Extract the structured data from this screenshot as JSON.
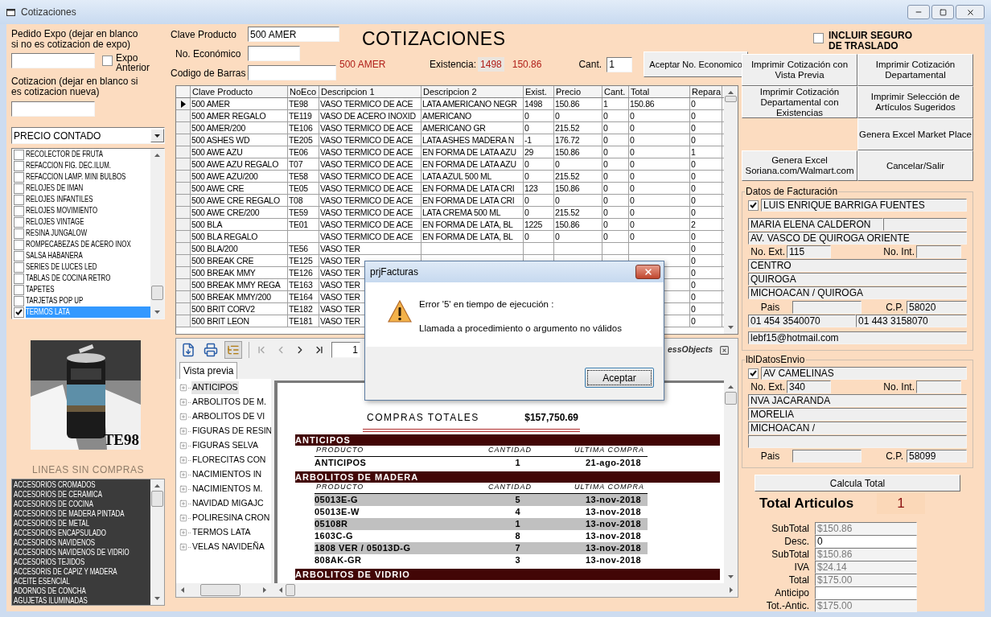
{
  "window": {
    "title": "Cotizaciones"
  },
  "pedido_expo": {
    "label": "Pedido Expo (dejar en blanco si no es cotizacion de expo)",
    "expo_anterior": {
      "label": "Expo Anterior",
      "checked": false
    }
  },
  "cotizacion": {
    "label": "Cotizacion (dejar en blanco si es cotizacion nueva)"
  },
  "price_list": {
    "value": "PRECIO CONTADO"
  },
  "lineas": [
    {
      "label": "RECOLECTOR DE FRUTA",
      "checked": false,
      "selected": false
    },
    {
      "label": "REFACCION FIG. DEC.ILUM.",
      "checked": false,
      "selected": false
    },
    {
      "label": "REFACCION LAMP. MINI BULBOS",
      "checked": false,
      "selected": false
    },
    {
      "label": "RELOJES DE IMAN",
      "checked": false,
      "selected": false
    },
    {
      "label": "RELOJES INFANTILES",
      "checked": false,
      "selected": false
    },
    {
      "label": "RELOJES MOVIMIENTO",
      "checked": false,
      "selected": false
    },
    {
      "label": "RELOJES VINTAGE",
      "checked": false,
      "selected": false
    },
    {
      "label": "RESINA JUNGALOW",
      "checked": false,
      "selected": false
    },
    {
      "label": "ROMPECABEZAS DE ACERO INOX",
      "checked": false,
      "selected": false
    },
    {
      "label": "SALSA HABANERA",
      "checked": false,
      "selected": false
    },
    {
      "label": "SERIES DE LUCES LED",
      "checked": false,
      "selected": false
    },
    {
      "label": "TABLAS DE COCINA RETRO",
      "checked": false,
      "selected": false
    },
    {
      "label": "TAPETES",
      "checked": false,
      "selected": false
    },
    {
      "label": "TARJETAS POP UP",
      "checked": false,
      "selected": false
    },
    {
      "label": "TERMOS LATA",
      "checked": true,
      "selected": true
    }
  ],
  "product_image": {
    "kind": "picture",
    "code": "TE98"
  },
  "lineas_sin_compras": {
    "title": "LINEAS SIN COMPRAS",
    "items": [
      "ACCESORIOS CROMADOS",
      "ACCESORIOS DE CERAMICA",
      "ACCESORIOS DE COCINA",
      "ACCESORIOS DE MADERA PINTADA",
      "ACCESORIOS DE METAL",
      "ACCESORIOS ENCAPSULADO",
      "ACCESORIOS NAVIDENOS",
      "ACCESORIOS NAVIDENOS DE VIDRIO",
      "ACCESORIOS TEJIDOS",
      "ACCESORIS DE CAPIZ Y MADERA",
      "ACEITE ESENCIAL",
      "ADORNOS DE CONCHA",
      "AGUJETAS ILUMINADAS"
    ]
  },
  "form": {
    "title": "COTIZACIONES",
    "clave_producto": {
      "label": "Clave Producto",
      "value": "500 AMER"
    },
    "no_economico": {
      "label": "No. Económico"
    },
    "codigo_barras": {
      "label": "Codigo de Barras"
    },
    "producto": "500 AMER",
    "existencia": {
      "label": "Existencia:",
      "value": "1498"
    },
    "precio": "150.86",
    "cantidad": {
      "label": "Cant.",
      "value": "1"
    },
    "accept_button": "Aceptar No. Economico"
  },
  "grid": {
    "columns": [
      "Clave Producto",
      "NoEco",
      "Descripcion 1",
      "Descripcion 2",
      "Exist.",
      "Precio",
      "Cant.",
      "Total",
      "Repara"
    ],
    "rows": [
      {
        "selected": true,
        "clave": "500 AMER",
        "no_eco": "TE98",
        "descripcion_1": "VASO TERMICO DE ACE",
        "descripcion_2": "LATA AMERICANO NEGR",
        "exist": "1498",
        "precio": "150.86",
        "cant": "1",
        "total": "150.86",
        "repara": "0"
      },
      {
        "selected": false,
        "clave": "500 AMER REGALO",
        "no_eco": "TE119",
        "descripcion_1": "VASO DE ACERO INOXID",
        "descripcion_2": "AMERICANO",
        "exist": "0",
        "precio": "0",
        "cant": "0",
        "total": "0",
        "repara": "0"
      },
      {
        "selected": false,
        "clave": "500 AMER/200",
        "no_eco": "TE106",
        "descripcion_1": "VASO TERMICO DE ACE",
        "descripcion_2": "AMERICANO GR",
        "exist": "0",
        "precio": "215.52",
        "cant": "0",
        "total": "0",
        "repara": "0"
      },
      {
        "selected": false,
        "clave": "500 ASHES WD",
        "no_eco": "TE205",
        "descripcion_1": "VASO TERMICO DE ACE",
        "descripcion_2": "LATA ASHES MADERA N",
        "exist": "-1",
        "precio": "176.72",
        "cant": "0",
        "total": "0",
        "repara": "0"
      },
      {
        "selected": false,
        "clave": "500 AWE AZU",
        "no_eco": "TE06",
        "descripcion_1": "VASO TERMICO DE ACE",
        "descripcion_2": "EN FORMA DE LATA AZU",
        "exist": "29",
        "precio": "150.86",
        "cant": "0",
        "total": "0",
        "repara": "1"
      },
      {
        "selected": false,
        "clave": "500 AWE AZU REGALO",
        "no_eco": "T07",
        "descripcion_1": "VASO TERMICO DE ACE",
        "descripcion_2": "EN FORMA DE LATA AZU",
        "exist": "0",
        "precio": "0",
        "cant": "0",
        "total": "0",
        "repara": "0"
      },
      {
        "selected": false,
        "clave": "500 AWE AZU/200",
        "no_eco": "TE58",
        "descripcion_1": "VASO TERMICO DE ACE",
        "descripcion_2": "LATA AZUL 500 ML",
        "exist": "0",
        "precio": "215.52",
        "cant": "0",
        "total": "0",
        "repara": "0"
      },
      {
        "selected": false,
        "clave": "500 AWE CRE",
        "no_eco": "TE05",
        "descripcion_1": "VASO TERMICO DE ACE",
        "descripcion_2": "EN FORMA DE LATA CRI",
        "exist": "123",
        "precio": "150.86",
        "cant": "0",
        "total": "0",
        "repara": "0"
      },
      {
        "selected": false,
        "clave": "500 AWE CRE REGALO",
        "no_eco": "T08",
        "descripcion_1": "VASO TERMICO DE ACE",
        "descripcion_2": "EN FORMA DE LATA CRI",
        "exist": "0",
        "precio": "0",
        "cant": "0",
        "total": "0",
        "repara": "0"
      },
      {
        "selected": false,
        "clave": "500 AWE CRE/200",
        "no_eco": "TE59",
        "descripcion_1": "VASO TERMICO DE ACE",
        "descripcion_2": "LATA CREMA 500 ML",
        "exist": "0",
        "precio": "215.52",
        "cant": "0",
        "total": "0",
        "repara": "0"
      },
      {
        "selected": false,
        "clave": "500 BLA",
        "no_eco": "TE01",
        "descripcion_1": "VASO TERMICO DE ACE",
        "descripcion_2": "EN FORMA DE LATA, BL",
        "exist": "1225",
        "precio": "150.86",
        "cant": "0",
        "total": "0",
        "repara": "2"
      },
      {
        "selected": false,
        "clave": "500 BLA REGALO",
        "descripcion_1": "VASO TERMICO DE ACE",
        "descripcion_2": "EN FORMA DE LATA, BL",
        "exist": "0",
        "precio": "0",
        "cant": "0",
        "total": "0",
        "repara": "0"
      },
      {
        "selected": false,
        "clave": "500 BLA/200",
        "no_eco": "TE56",
        "descripcion_1": "VASO TER",
        "repara": "0"
      },
      {
        "selected": false,
        "clave": "500 BREAK CRE",
        "no_eco": "TE125",
        "descripcion_1": "VASO TER",
        "repara": "0"
      },
      {
        "selected": false,
        "clave": "500 BREAK MMY",
        "no_eco": "TE126",
        "descripcion_1": "VASO TER",
        "repara": "0"
      },
      {
        "selected": false,
        "clave": "500 BREAK MMY REGA",
        "no_eco": "TE163",
        "descripcion_1": "VASO TER",
        "repara": "0"
      },
      {
        "selected": false,
        "clave": "500 BREAK MMY/200",
        "no_eco": "TE164",
        "descripcion_1": "VASO TER",
        "repara": "0"
      },
      {
        "selected": false,
        "clave": "500 BRIT CORV2",
        "no_eco": "TE182",
        "descripcion_1": "VASO TER",
        "repara": "0"
      },
      {
        "selected": false,
        "clave": "500 BRIT LEON",
        "no_eco": "TE181",
        "descripcion_1": "VASO TER",
        "repara": "0"
      }
    ]
  },
  "report_viewer": {
    "nav": [
      {
        "kind": "first",
        "disabled": true
      },
      {
        "kind": "prev",
        "disabled": true
      },
      {
        "kind": "next",
        "disabled": false
      },
      {
        "kind": "last",
        "disabled": false
      }
    ],
    "page": "1",
    "logo": "essObjects",
    "tab": "Vista previa",
    "tree": [
      {
        "label": "ANTICIPOS",
        "selected": true
      },
      {
        "label": "ARBOLITOS DE M.",
        "selected": false
      },
      {
        "label": "ARBOLITOS DE VI",
        "selected": false
      },
      {
        "label": "FIGURAS DE RESIN",
        "selected": false
      },
      {
        "label": "FIGURAS SELVA",
        "selected": false
      },
      {
        "label": "FLORECITAS CON",
        "selected": false
      },
      {
        "label": "NACIMIENTOS IN",
        "selected": false
      },
      {
        "label": "NACIMIENTOS M.",
        "selected": false
      },
      {
        "label": "NAVIDAD MIGAJC",
        "selected": false
      },
      {
        "label": "POLIRESINA CRON",
        "selected": false
      },
      {
        "label": "TERMOS LATA",
        "selected": false
      },
      {
        "label": "VELAS NAVIDEÑA",
        "selected": false
      }
    ],
    "report": {
      "title": "COMPRAS TOTALES",
      "total": "$157,750.69",
      "sections": [
        {
          "title": "ANTICIPOS",
          "columns": [
            "PRODUCTO",
            "CANTIDAD",
            "ULTIMA COMPRA"
          ],
          "rows": [
            {
              "producto": "ANTICIPOS",
              "cantidad": "1",
              "ultima_compra": "21-ago-2018",
              "shaded": false
            }
          ]
        },
        {
          "title": "ARBOLITOS DE MADERA",
          "columns": [
            "PRODUCTO",
            "CANTIDAD",
            "ULTIMA COMPRA"
          ],
          "rows": [
            {
              "producto": "05013E-G",
              "cantidad": "5",
              "ultima_compra": "13-nov-2018",
              "shaded": true
            },
            {
              "producto": "05013E-W",
              "cantidad": "4",
              "ultima_compra": "13-nov-2018",
              "shaded": false
            },
            {
              "producto": "05108R",
              "cantidad": "1",
              "ultima_compra": "13-nov-2018",
              "shaded": true
            },
            {
              "producto": "1603C-G",
              "cantidad": "8",
              "ultima_compra": "13-nov-2018",
              "shaded": false
            },
            {
              "producto": "1808 VER / 05013D-G",
              "cantidad": "7",
              "ultima_compra": "13-nov-2018",
              "shaded": true
            },
            {
              "producto": "808AK-GR",
              "cantidad": "3",
              "ultima_compra": "13-nov-2018",
              "shaded": false
            }
          ]
        },
        {
          "title": "ARBOLITOS DE VIDRIO"
        }
      ]
    }
  },
  "seguro": {
    "label": "INCLUIR SEGURO DE TRASLADO",
    "checked": false
  },
  "buttons": [
    "Imprimir Cotización con Vista Previa",
    "Imprimir Cotización Departamental",
    "Imprimir Cotización Departamental con Existencias",
    "Imprimir Selección de Artículos Sugeridos",
    "Genera Excel Market Place",
    "Genera Excel Soriana.com/Walmart.com",
    "Cancelar/Salir"
  ],
  "facturacion": {
    "legend": "Datos de Facturación",
    "checked": true,
    "nombre": "LUIS ENRIQUE BARRIGA FUENTES",
    "contacto": "MARIA ELENA CALDERON",
    "calle": "AV. VASCO DE QUIROGA ORIENTE",
    "no_ext": {
      "label": "No. Ext.",
      "value": "115"
    },
    "no_int": {
      "label": "No. Int."
    },
    "colonia": "CENTRO",
    "ciudad": "QUIROGA",
    "estado": "MICHOACAN / QUIROGA",
    "pais": {
      "label": "Pais"
    },
    "cp": {
      "label": "C.P.",
      "value": "58020"
    },
    "telefonos": [
      "01 454 3540070",
      "01 443 3158070"
    ],
    "email": "lebf15@hotmail.com"
  },
  "envio": {
    "legend": "lblDatosEnvio",
    "checked": true,
    "calle": "AV CAMELINAS",
    "no_ext": {
      "label": "No. Ext.",
      "value": "340"
    },
    "no_int": {
      "label": "No. Int."
    },
    "colonia": "NVA JACARANDA",
    "ciudad": "MORELIA",
    "estado": "MICHOACAN /",
    "pais": {
      "label": "Pais"
    },
    "cp": {
      "label": "C.P.",
      "value": "58099"
    }
  },
  "totals": {
    "calcula_button": "Calcula Total",
    "articulos": {
      "label": "Total Articulos",
      "value": "1"
    },
    "rows": [
      {
        "label": "SubTotal",
        "value": "$150.86",
        "disabled": true
      },
      {
        "label": "Desc.",
        "value": "0",
        "disabled": false
      },
      {
        "label": "SubTotal",
        "value": "$150.86",
        "disabled": true
      },
      {
        "label": "IVA",
        "value": "$24.14",
        "disabled": true
      },
      {
        "label": "Total",
        "value": "$175.00",
        "disabled": true
      },
      {
        "label": "Anticipo",
        "disabled": false
      },
      {
        "label": "Tot.-Antic.",
        "value": "$175.00",
        "disabled": true
      }
    ]
  },
  "dialog": {
    "title": "prjFacturas",
    "message": [
      "Error '5' en tiempo de ejecución :",
      "Llamada a procedimiento o argumento no válidos"
    ],
    "button": "Aceptar"
  }
}
